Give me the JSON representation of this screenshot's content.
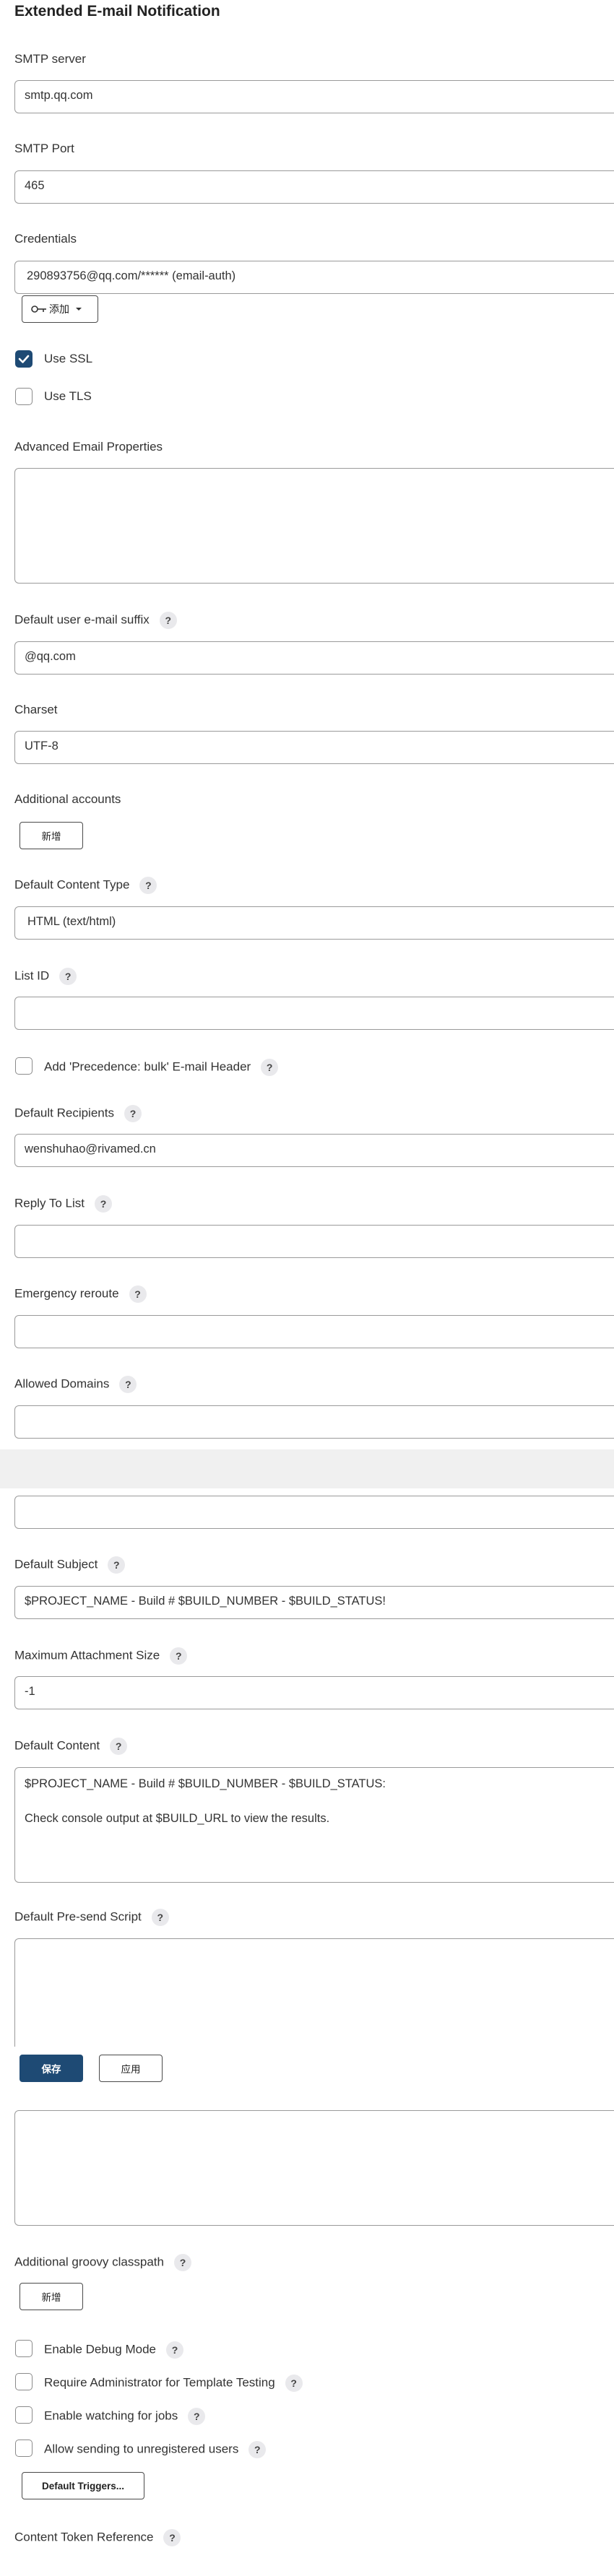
{
  "section_title": "Extended E-mail Notification",
  "smtp_server": {
    "label": "SMTP server",
    "value": "smtp.qq.com"
  },
  "smtp_port": {
    "label": "SMTP Port",
    "value": "465"
  },
  "credentials": {
    "label": "Credentials",
    "value": "290893756@qq.com/****** (email-auth)",
    "add_label": "添加"
  },
  "use_ssl": {
    "label": "Use SSL",
    "checked": true
  },
  "use_tls": {
    "label": "Use TLS",
    "checked": false
  },
  "advanced_email_properties": {
    "label": "Advanced Email Properties"
  },
  "default_suffix": {
    "label": "Default user e-mail suffix",
    "value": "@qq.com"
  },
  "charset": {
    "label": "Charset",
    "value": "UTF-8"
  },
  "additional_accounts": {
    "label": "Additional accounts",
    "add_label": "新增"
  },
  "default_content_type": {
    "label": "Default Content Type",
    "value": "HTML (text/html)"
  },
  "list_id": {
    "label": "List ID",
    "value": ""
  },
  "precedence_bulk": {
    "label": "Add 'Precedence: bulk' E-mail Header",
    "checked": false
  },
  "default_recipients": {
    "label": "Default Recipients",
    "value": "wenshuhao@rivamed.cn"
  },
  "reply_to_list": {
    "label": "Reply To List",
    "value": ""
  },
  "emergency_reroute": {
    "label": "Emergency reroute",
    "value": ""
  },
  "allowed_domains": {
    "label": "Allowed Domains",
    "value": ""
  },
  "excluded_recipients": {
    "value": ""
  },
  "default_subject": {
    "label": "Default Subject",
    "value": "$PROJECT_NAME - Build # $BUILD_NUMBER - $BUILD_STATUS!"
  },
  "max_attachment_size": {
    "label": "Maximum Attachment Size",
    "value": "-1"
  },
  "default_content": {
    "label": "Default Content",
    "line1": "$PROJECT_NAME - Build # $BUILD_NUMBER - $BUILD_STATUS:",
    "line2": "Check console output at $BUILD_URL to view the results."
  },
  "default_presend_script": {
    "label": "Default Pre-send Script"
  },
  "save_bar": {
    "save_label": "保存",
    "apply_label": "应用"
  },
  "additional_groovy_classpath": {
    "label": "Additional groovy classpath",
    "add_label": "新增"
  },
  "enable_debug_mode": {
    "label": "Enable Debug Mode",
    "checked": false
  },
  "require_admin": {
    "label": "Require Administrator for Template Testing",
    "checked": false
  },
  "enable_watching": {
    "label": "Enable watching for jobs",
    "checked": false
  },
  "allow_unregistered": {
    "label": "Allow sending to unregistered users",
    "checked": false
  },
  "default_triggers": {
    "label": "Default Triggers..."
  },
  "content_token_reference": {
    "label": "Content Token Reference"
  },
  "help_glyph": "?",
  "colors": {
    "primary": "#1e4a74",
    "border": "#9a9a9a",
    "help_bg": "#e9e9ec"
  }
}
